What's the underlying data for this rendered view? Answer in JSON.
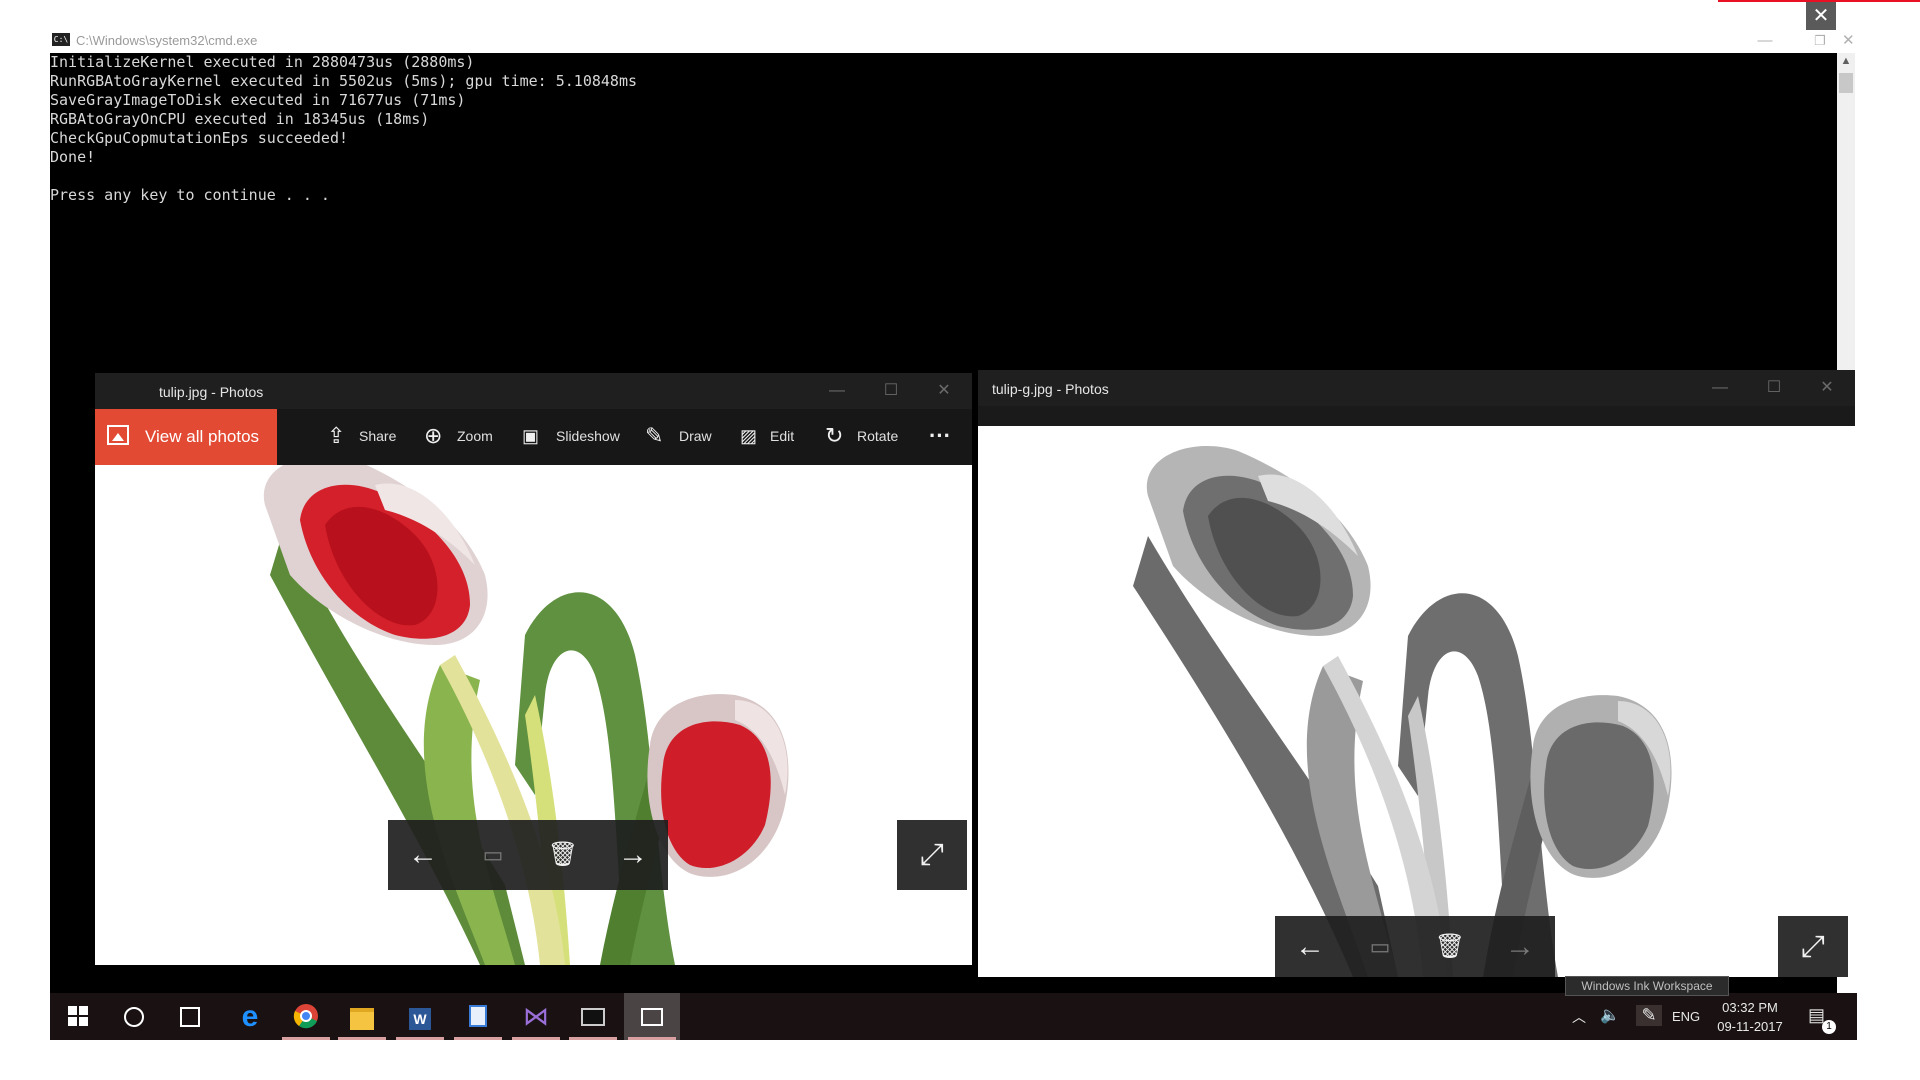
{
  "cmd": {
    "title": "C:\\Windows\\system32\\cmd.exe",
    "output": "InitializeKernel executed in 2880473us (2880ms)\nRunRGBAtoGrayKernel executed in 5502us (5ms); gpu time: 5.10848ms\nSaveGrayImageToDisk executed in 71677us (71ms)\nRGBAtoGrayOnCPU executed in 18345us (18ms)\nCheckGpuCopmutationEps succeeded!\nDone!\n\nPress any key to continue . . ."
  },
  "photos_left": {
    "title": "tulip.jpg - Photos",
    "view_all": "View all photos",
    "toolbar": {
      "share": "Share",
      "zoom": "Zoom",
      "slideshow": "Slideshow",
      "draw": "Draw",
      "edit": "Edit",
      "rotate": "Rotate",
      "more": "···"
    }
  },
  "photos_right": {
    "title": "tulip-g.jpg - Photos"
  },
  "tooltip": "Windows Ink Workspace",
  "tray": {
    "language": "ENG",
    "time": "03:32 PM",
    "date": "09-11-2017",
    "notification_count": "1"
  },
  "icons": {
    "start": "windows-icon",
    "search": "cortana-circle-icon",
    "task_view": "task-view-icon",
    "edge": "edge-icon",
    "chrome": "chrome-icon",
    "explorer": "folder-icon",
    "word": "word-icon",
    "file": "document-icon",
    "visual_studio": "visual-studio-icon",
    "cmd": "cmd-icon",
    "photos": "photos-icon"
  },
  "colors": {
    "accent": "#e24a33",
    "toolbar": "#171717",
    "titlebar": "#1f1f1f",
    "taskbar": "#1a1212"
  }
}
